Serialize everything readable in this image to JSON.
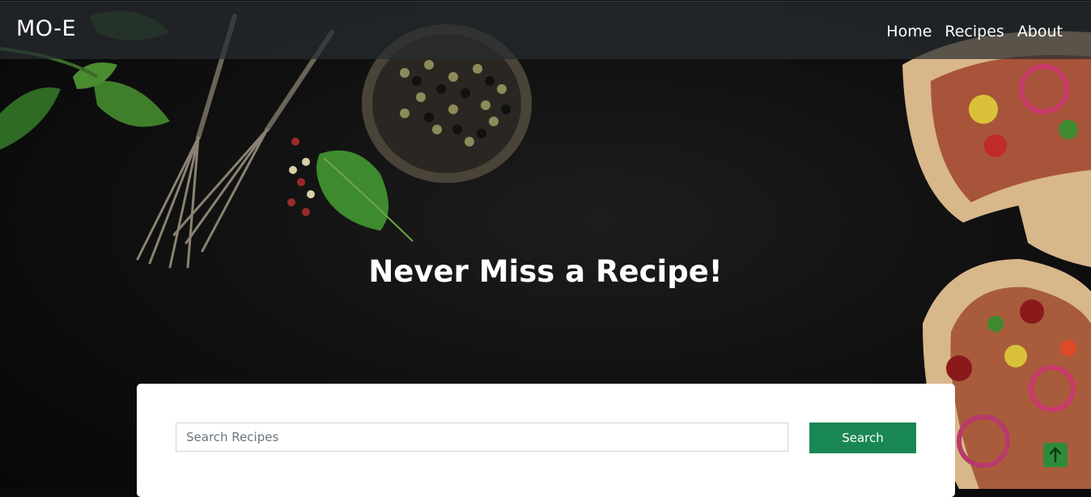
{
  "navbar": {
    "brand": "MO-E",
    "links": [
      "Home",
      "Recipes",
      "About"
    ]
  },
  "hero": {
    "headline": "Never Miss a Recipe!"
  },
  "search": {
    "placeholder": "Search Recipes",
    "value": "",
    "button_label": "Search"
  },
  "icons": {
    "scroll_top": "arrow-up-icon"
  },
  "colors": {
    "accent": "#198754",
    "navbar_bg": "#282c30",
    "hero_bg": "#111111"
  }
}
